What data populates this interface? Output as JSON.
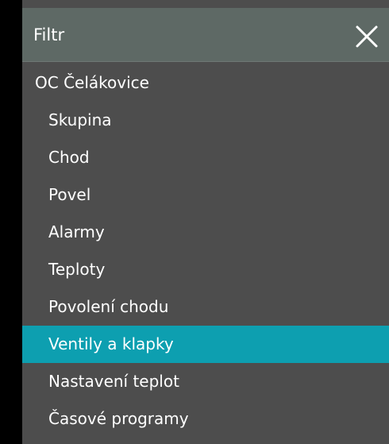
{
  "filter_panel": {
    "title": "Filtr",
    "close_icon": "close-icon",
    "root_item": "OC Čelákovice",
    "items": [
      {
        "label": "Skupina",
        "active": false
      },
      {
        "label": "Chod",
        "active": false
      },
      {
        "label": "Povel",
        "active": false
      },
      {
        "label": "Alarmy",
        "active": false
      },
      {
        "label": "Teploty",
        "active": false
      },
      {
        "label": "Povolení chodu",
        "active": false
      },
      {
        "label": "Ventily a klapky",
        "active": true
      },
      {
        "label": "Nastavení teplot",
        "active": false
      },
      {
        "label": "Časové programy",
        "active": false
      }
    ]
  },
  "colors": {
    "header_bg": "#5e6965",
    "panel_bg": "#4d4d4d",
    "active_bg": "#0d9fb0",
    "text": "#ffffff"
  }
}
